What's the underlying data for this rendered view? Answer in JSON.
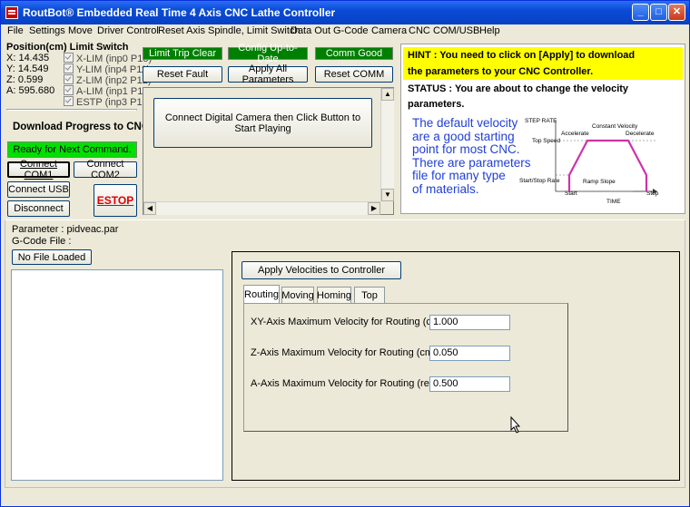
{
  "window": {
    "title": "RoutBot® Embedded Real Time 4 Axis CNC Lathe Controller"
  },
  "menu": [
    "File",
    "Settings",
    "Move",
    "Driver Control",
    "Reset Axis",
    "Spindle, Limit Switch",
    "Data Out",
    "G-Code",
    "Camera",
    "CNC",
    "COM/USB",
    "Help"
  ],
  "position": {
    "header": "Position(cm) Limit Switch",
    "x": "X: 14.435",
    "y": "Y: 14.549",
    "z": "Z: 0.599",
    "a": "A: 595.680"
  },
  "limits": [
    "X-LIM (inp0 P15)",
    "Y-LIM (inp4 P11)",
    "Z-LIM (inp2 P12)",
    "A-LIM (inp1 P13)",
    "ESTP (inp3 P10)"
  ],
  "status_leds": {
    "limit": "Limit Trip Clear",
    "config": "Config Up-to-Date",
    "comm": "Comm Good"
  },
  "buttons": {
    "reset_fault": "Reset Fault",
    "apply_all": "Apply All Parameters",
    "reset_comm": "Reset COMM",
    "connect_com1": "Connect COM1",
    "connect_com2": "Connect COM2",
    "connect_usb": "Connect USB",
    "disconnect": "Disconnect",
    "estop": "ESTOP",
    "no_file": "No File Loaded",
    "apply_velocities": "Apply Velocities to Controller"
  },
  "download": {
    "title": "Download Progress to CNC",
    "status": "Ready for Next Command."
  },
  "camera": {
    "message": "Connect Digital Camera then Click Button to Start Playing"
  },
  "hint": {
    "line1": "HINT : You need to click on [Apply] to download",
    "line2": "the parameters to your CNC Controller.",
    "status1": "STATUS : You are about to change the velocity",
    "status2": "parameters.",
    "body": [
      "The default velocity",
      "are a good starting",
      "point for most CNC.",
      "There are parameters",
      "file for many type",
      "of materials."
    ]
  },
  "diagram": {
    "step_rate": "STEP RATE",
    "top_speed": "Top Speed",
    "start_stop_rate": "Start/Stop Rate",
    "accelerate": "Accelerate",
    "constant_velocity": "Constant Velocity",
    "decelerate": "Decelerate",
    "ramp_slope": "Ramp Slope",
    "start": "Start",
    "time": "TIME",
    "stop": "Stop",
    "line_color": "#cc33aa"
  },
  "files": {
    "parameter": "Parameter : pidveac.par",
    "gcode": "G-Code File :"
  },
  "tabs": [
    "Routing",
    "Moving",
    "Homing",
    "Top"
  ],
  "velocities": [
    {
      "label": "XY-Axis Maximum Velocity for Routing  (cm/sec):",
      "value": "1.000"
    },
    {
      "label": "Z-Axis  Maximum Velocity for Routing  (cm/sec):",
      "value": "0.050"
    },
    {
      "label": "A-Axis  Maximum Velocity for Routing  (rev/sec):",
      "value": "0.500"
    }
  ]
}
